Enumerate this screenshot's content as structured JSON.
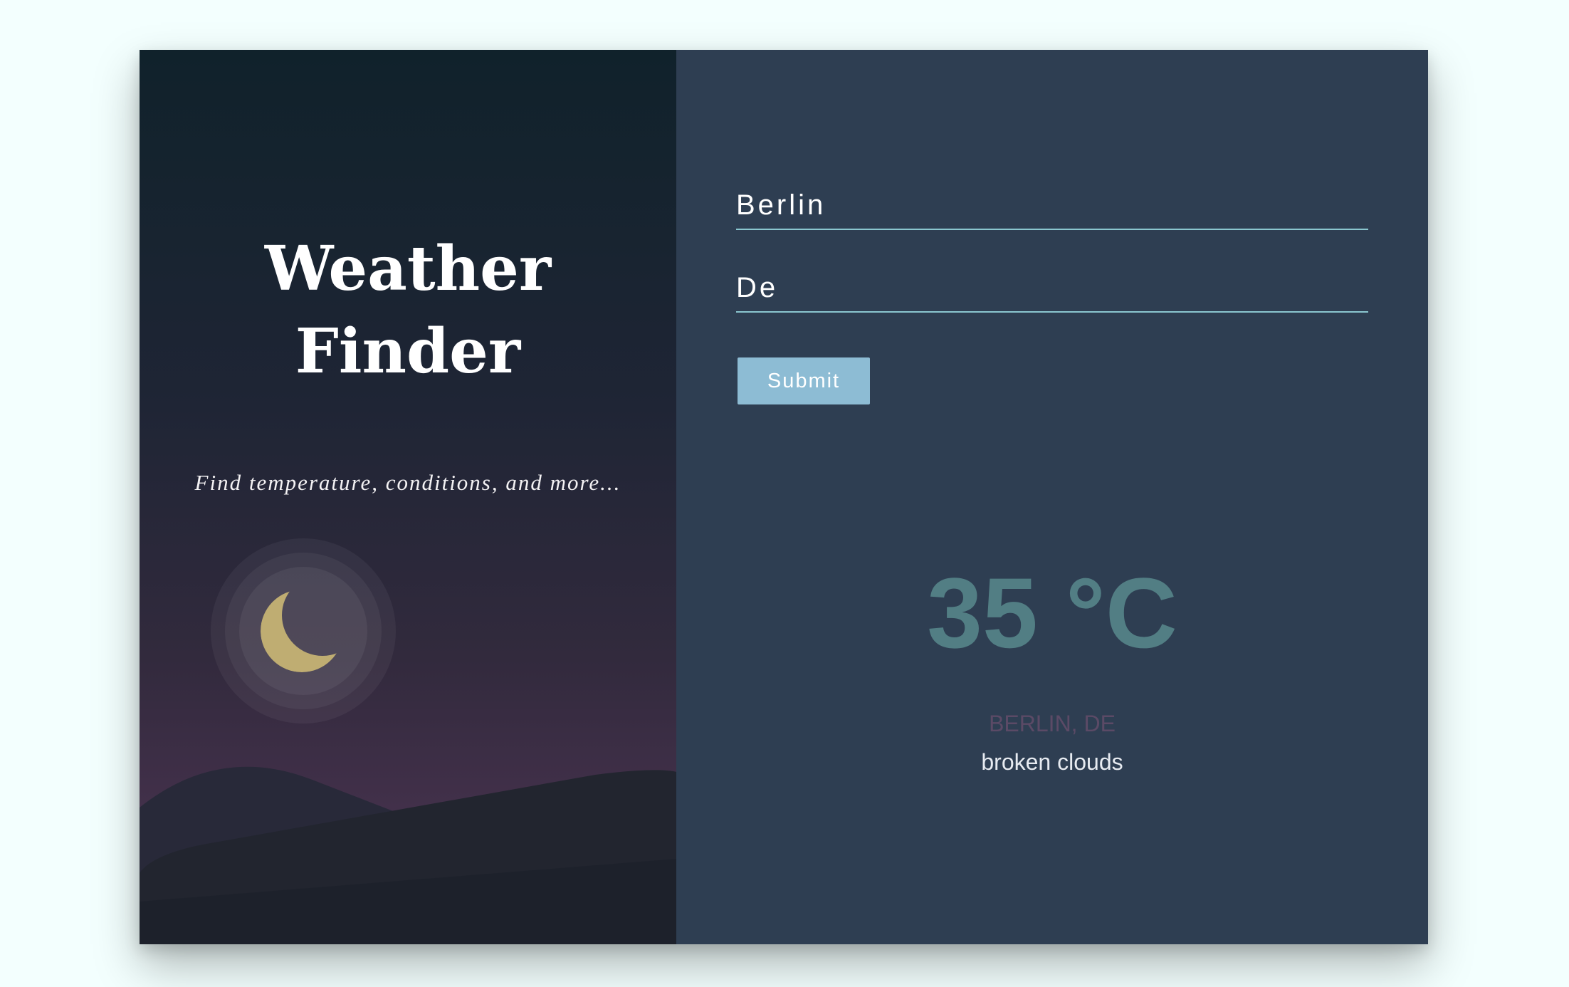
{
  "branding": {
    "title_line1": "Weather",
    "title_line2": "Finder",
    "subtitle": "Find temperature, conditions, and more..."
  },
  "form": {
    "city_value": "Berlin",
    "country_value": "De",
    "submit_label": "Submit"
  },
  "result": {
    "temperature": "35 °C",
    "location": "BERLIN, DE",
    "conditions": "broken clouds"
  },
  "icons": {
    "moon": "crescent-moon-icon"
  },
  "colors": {
    "page_background": "#f3fffe",
    "left_panel_top": "#10222b",
    "left_panel_bottom": "#42304a",
    "right_panel": "#2e3e52",
    "moon": "#bfad72",
    "submit_button": "#8dbcd4",
    "input_underline": "#8ac6cf",
    "temperature": "#527e84",
    "location": "#5b4a66",
    "conditions": "#e7ebf1"
  }
}
